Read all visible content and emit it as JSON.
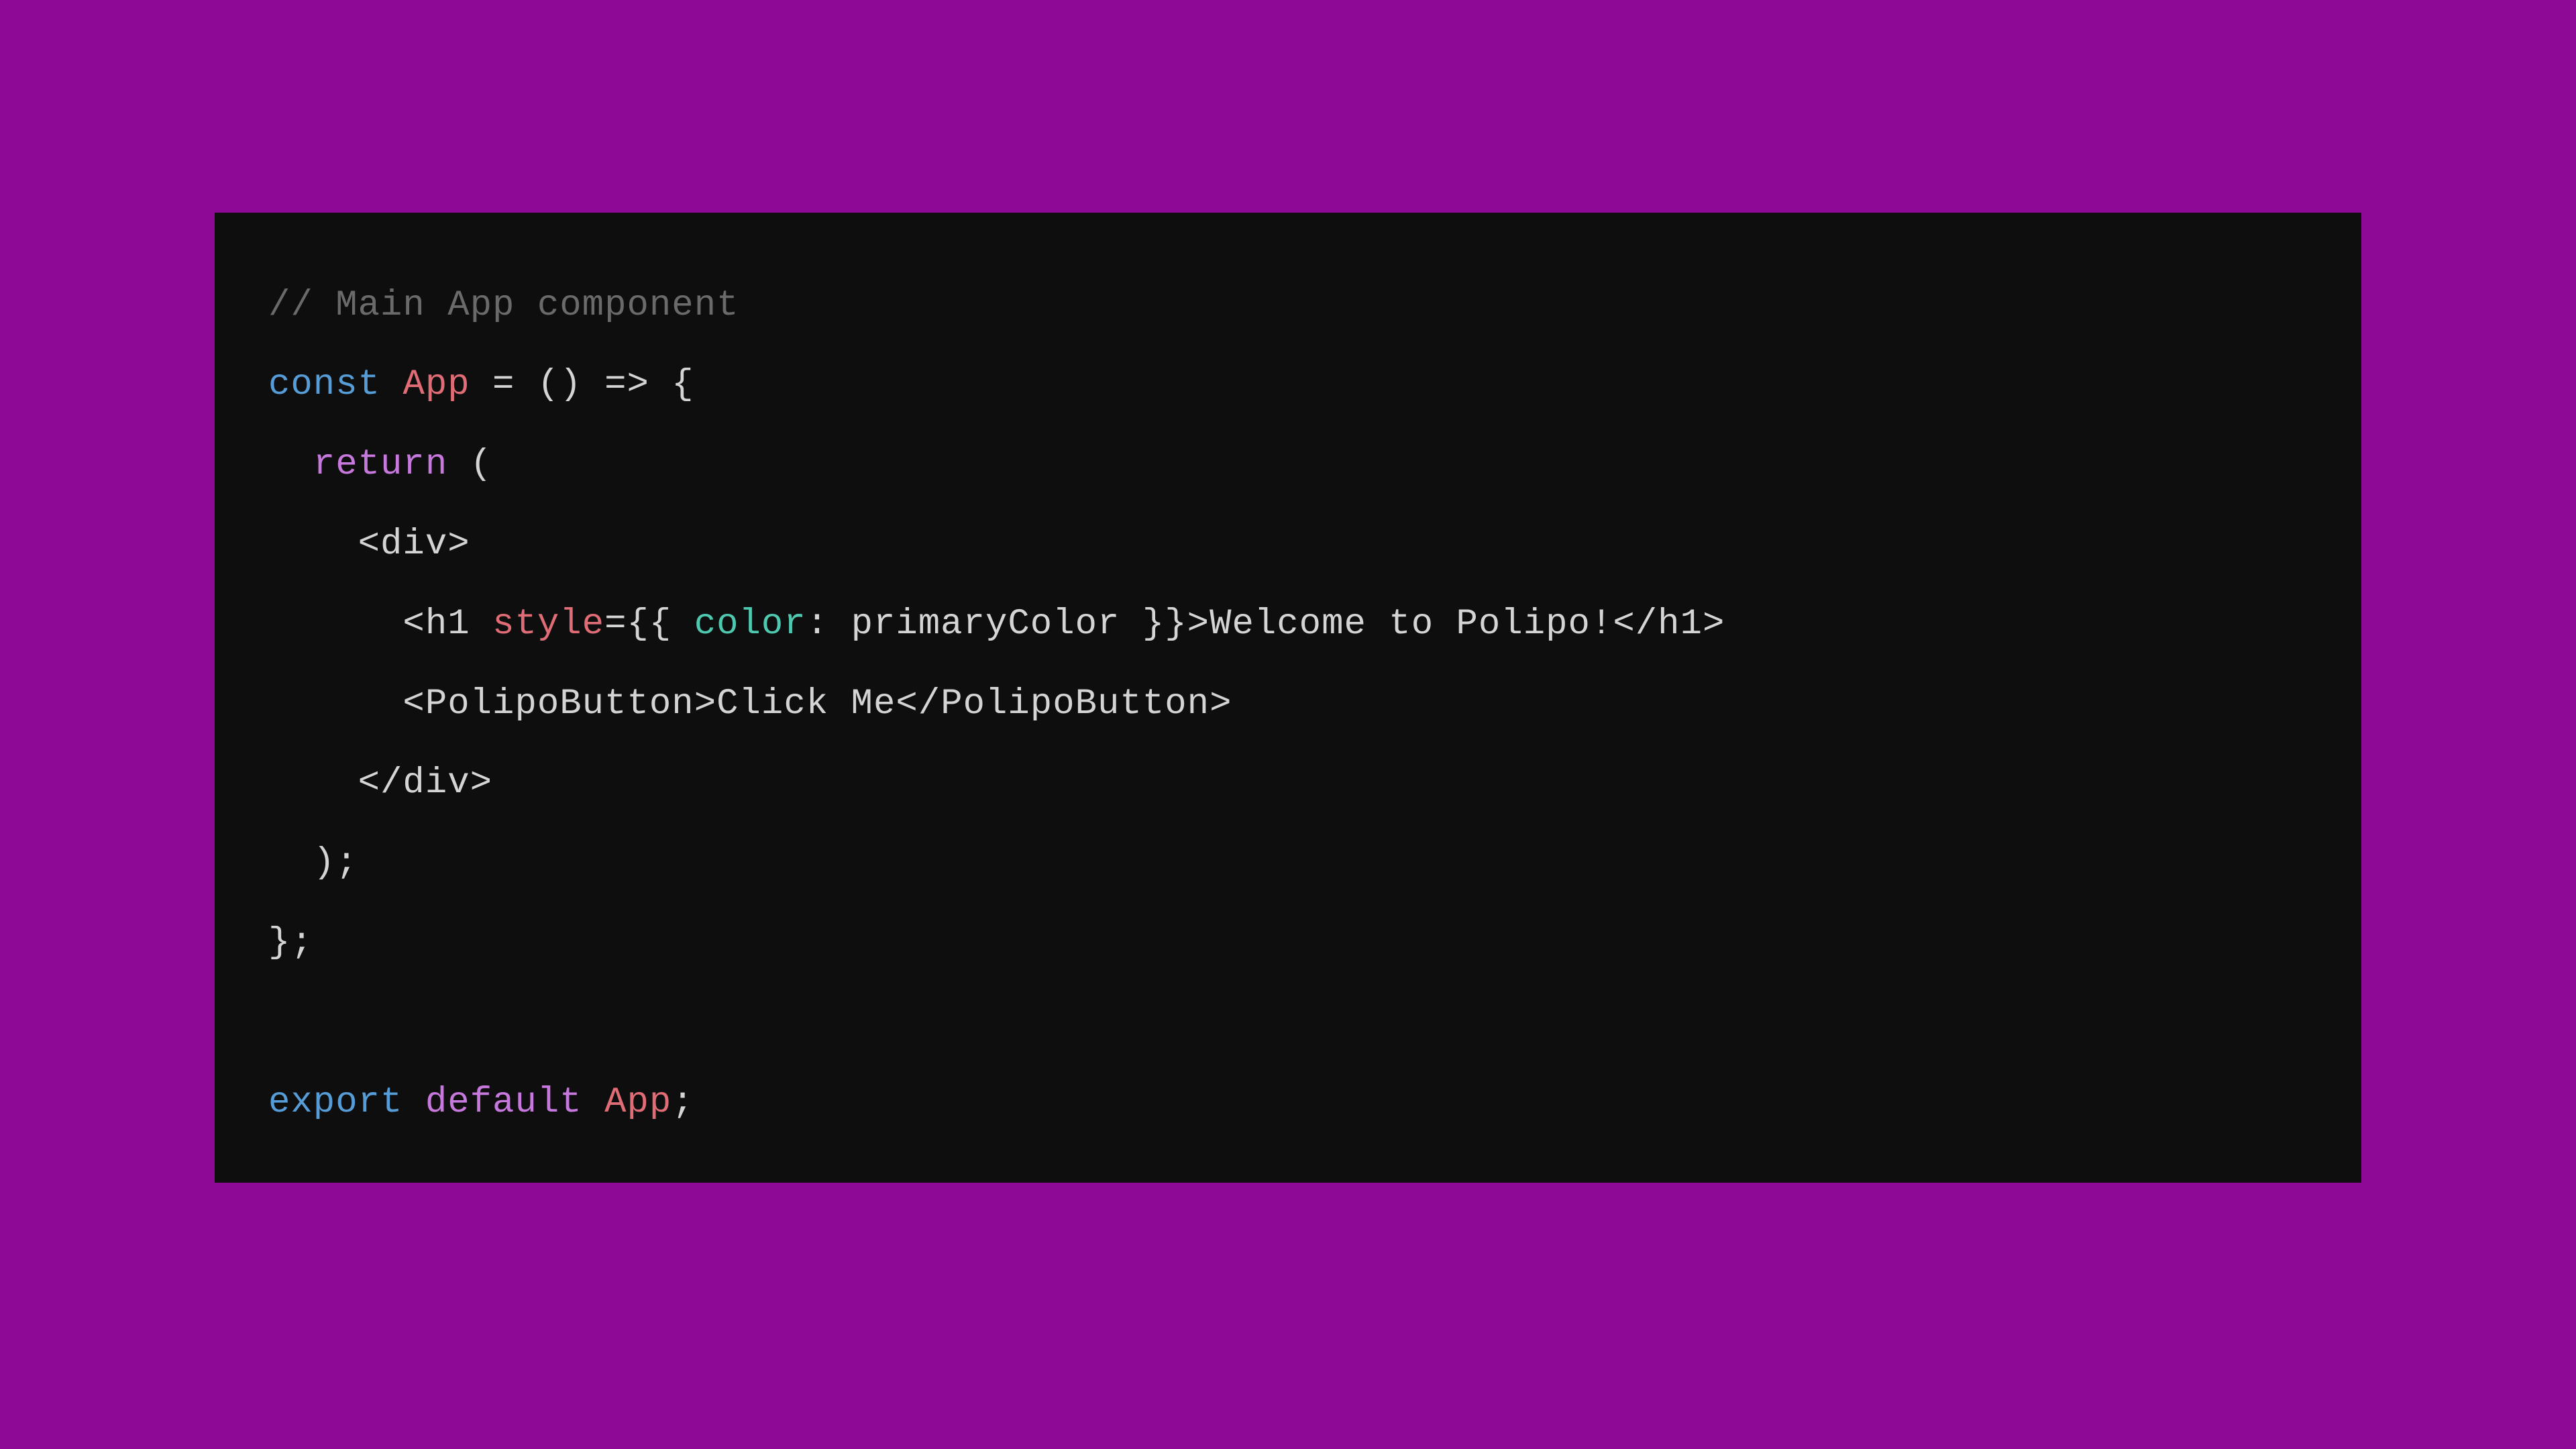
{
  "code": {
    "line1_comment": "// Main App component",
    "line2_const": "const",
    "line2_app": "App",
    "line2_rest": " = () => {",
    "line3_return": "return",
    "line3_paren": " (",
    "line4": "    <div>",
    "line5_indent": "      <",
    "line5_h1": "h1",
    "line5_space": " ",
    "line5_style": "style",
    "line5_eq": "=",
    "line5_braces1": "{{ ",
    "line5_color": "color",
    "line5_colon": ": ",
    "line5_primary": "primaryColor",
    "line5_braces2": " }}",
    "line5_gt": ">",
    "line5_text": "Welcome to Polipo!",
    "line5_close": "</",
    "line5_h1b": "h1",
    "line5_end": ">",
    "line6_open": "      <",
    "line6_comp": "PolipoButton",
    "line6_gt": ">",
    "line6_text": "Click Me",
    "line6_close": "</",
    "line6_comp2": "PolipoButton",
    "line6_end": ">",
    "line7": "    </div>",
    "line8": "  );",
    "line9": "};",
    "line10": "",
    "line11_export": "export",
    "line11_default": "default",
    "line11_app": "App",
    "line11_semi": ";"
  }
}
